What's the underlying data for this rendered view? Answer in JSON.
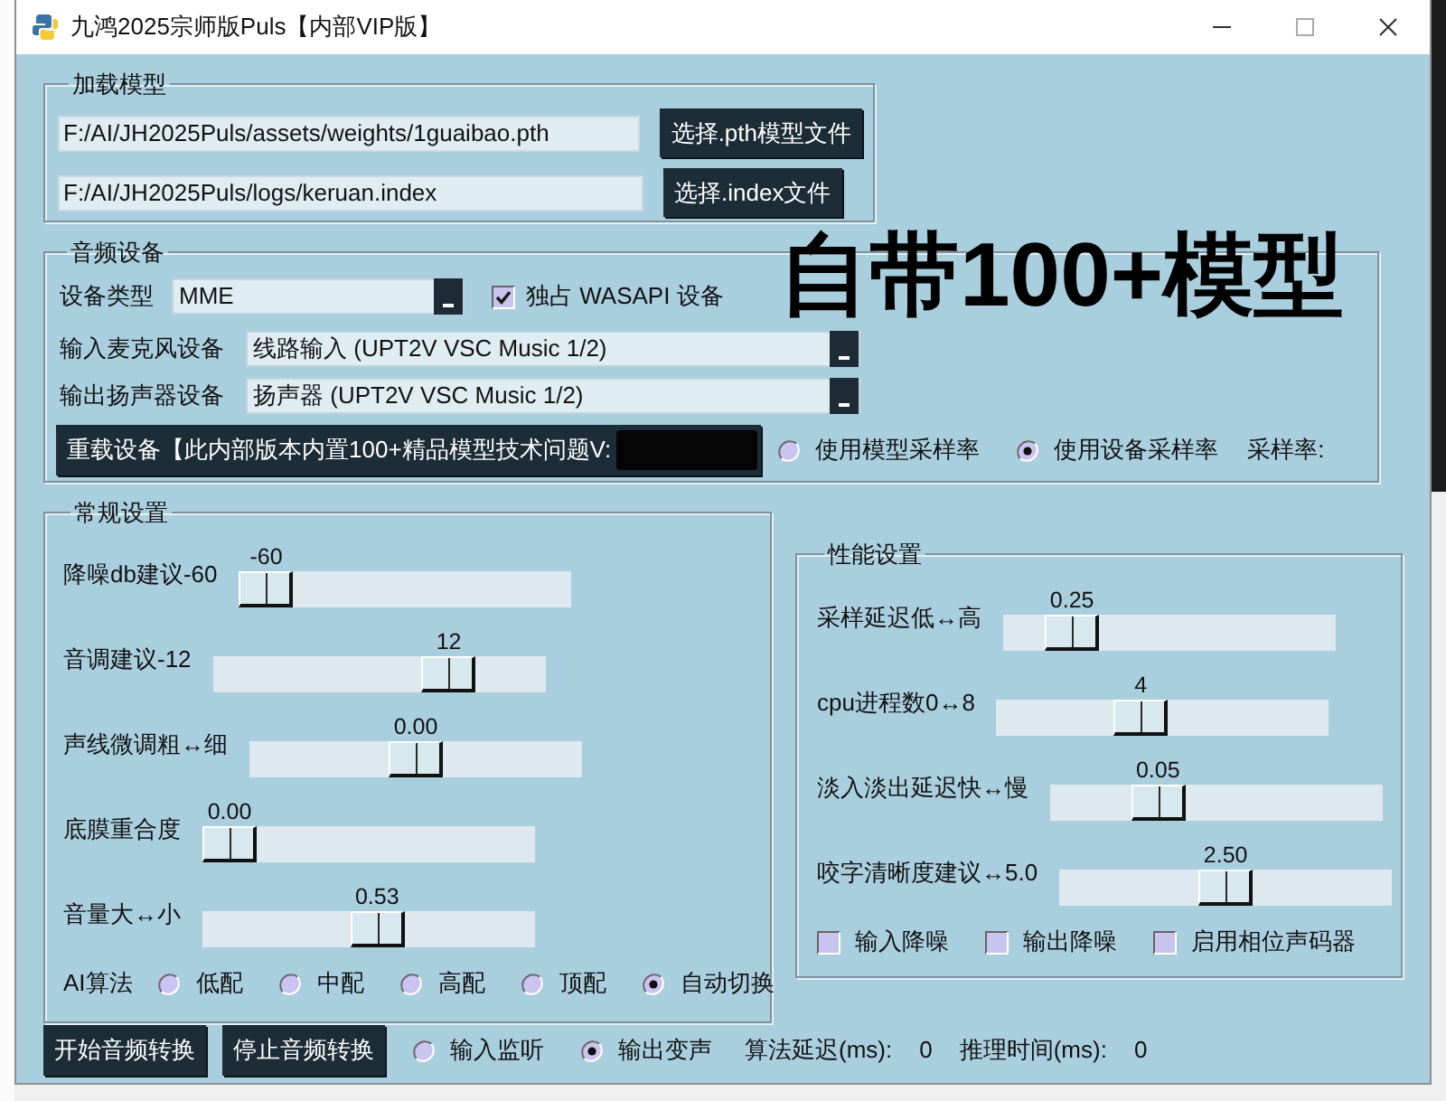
{
  "window": {
    "title": "九鸿2025宗师版Puls【内部VIP版】"
  },
  "overlay_text": "自带100+模型",
  "load_model": {
    "title": "加载模型",
    "files": [
      {
        "path": "F:/AI/JH2025Puls/assets/weights/1guaibao.pth",
        "button": "选择.pth模型文件"
      },
      {
        "path": "F:/AI/JH2025Puls/logs/keruan.index",
        "button": "选择.index文件"
      }
    ]
  },
  "audio_devices": {
    "title": "音频设备",
    "device_type": {
      "label": "设备类型",
      "value": "MME"
    },
    "exclusive": {
      "label": "独占 WASAPI 设备",
      "checked": true
    },
    "devices": [
      {
        "label": "输入麦克风设备",
        "value": "线路输入 (UPT2V VSC Music 1/2)"
      },
      {
        "label": "输出扬声器设备",
        "value": "扬声器 (UPT2V VSC Music 1/2)"
      }
    ],
    "reload_button": "重载设备【此内部版本内置100+精品模型技术问题V:",
    "sample_rate_modes": [
      {
        "label": "使用模型采样率",
        "selected": false
      },
      {
        "label": "使用设备采样率",
        "selected": true
      }
    ],
    "sample_rate_label": "采样率:"
  },
  "general": {
    "title": "常规设置",
    "sliders": [
      {
        "label": "降噪db建议-60",
        "reading": "-60",
        "level": 0
      },
      {
        "label": "音调建议-12",
        "reading": "12",
        "level": 0.75
      },
      {
        "label": "声线微调粗↔细",
        "reading": "0.00",
        "level": 0.5
      },
      {
        "label": "底膜重合度",
        "reading": "0.00",
        "level": 0
      },
      {
        "label": "音量大↔小",
        "reading": "0.53",
        "level": 0.53
      }
    ],
    "algorithm": {
      "label": "AI算法",
      "options": [
        {
          "label": "低配",
          "selected": false
        },
        {
          "label": "中配",
          "selected": false
        },
        {
          "label": "高配",
          "selected": false
        },
        {
          "label": "顶配",
          "selected": false
        },
        {
          "label": "自动切换",
          "selected": true
        }
      ]
    }
  },
  "performance": {
    "title": "性能设置",
    "sliders": [
      {
        "label": "采样延迟低↔高",
        "reading": "0.25",
        "level": 0.15
      },
      {
        "label": "cpu进程数0↔8",
        "reading": "4",
        "level": 0.42
      },
      {
        "label": "淡入淡出延迟快↔慢",
        "reading": "0.05",
        "level": 0.29
      },
      {
        "label": "咬字清晰度建议↔5.0",
        "reading": "2.50",
        "level": 0.5
      }
    ],
    "options": [
      {
        "label": "输入降噪",
        "checked": false
      },
      {
        "label": "输出降噪",
        "checked": false
      },
      {
        "label": "启用相位声码器",
        "checked": false
      }
    ]
  },
  "bottom_bar": {
    "buttons": [
      "开始音频转换",
      "停止音频转换"
    ],
    "modes": [
      {
        "label": "输入监听",
        "selected": false
      },
      {
        "label": "输出变声",
        "selected": true
      }
    ],
    "stats": [
      {
        "label": "算法延迟(ms):",
        "value": "0"
      },
      {
        "label": "推理时间(ms):",
        "value": "0"
      }
    ]
  }
}
